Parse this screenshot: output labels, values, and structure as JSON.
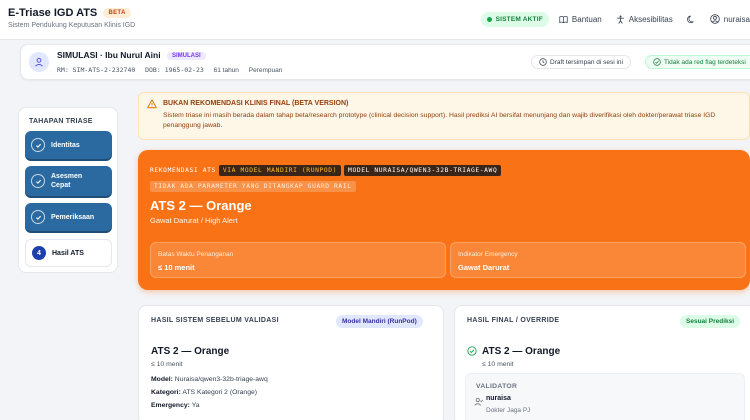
{
  "app": {
    "title": "E-Triase IGD ATS",
    "beta_label": "BETA",
    "subtitle": "Sistem Pendukung Keputusan Klinis IGD"
  },
  "topnav": {
    "status": "SISTEM AKTIF",
    "help": "Bantuan",
    "accessibility": "Aksesibilitas",
    "user": "nuraisa"
  },
  "patient": {
    "name": "SIMULASI · Ibu Nurul Aini",
    "sim_badge": "SIMULASI",
    "rm": "RM: SIM-ATS-2-232740",
    "dob": "DOB: 1965-02-23",
    "age": "61 tahun",
    "gender": "Perempuan",
    "draft_status": "Draft tersimpan di sesi ini",
    "redflag_status": "Tidak ada red flag terdeteksi"
  },
  "stepper": {
    "title": "TAHAPAN TRIASE",
    "steps": [
      {
        "label": "Identitas"
      },
      {
        "label": "Asesmen Cepat"
      },
      {
        "label": "Pemeriksaan"
      },
      {
        "label": "Hasil ATS",
        "number": "4"
      }
    ]
  },
  "warning": {
    "title": "BUKAN REKOMENDASI KLINIS FINAL (BETA VERSION)",
    "body": "Sistem triase ini masih berada dalam tahap beta/research prototype (clinical decision support). Hasil prediksi AI bersifat menunjang dan wajib diverifikasi oleh dokter/perawat triase IGD penanggung jawab."
  },
  "result": {
    "chip_prefix": "REKOMENDASI ATS",
    "chip_model_source": "VIA MODEL MANDIRI (RUNPOD)",
    "chip_model_name": "MODEL NURAISA/QWEN3-32B-TRIAGE-AWQ",
    "chip_guardrail": "TIDAK ADA PARAMETER YANG DITANGKAP GUARD RAIL",
    "level": "ATS 2 — Orange",
    "level_desc": "Gawat Darurat / High Alert",
    "time_label": "Batas Waktu Penanganan",
    "time_value": "≤ 10 menit",
    "emergency_label": "Indikator Emergency",
    "emergency_value": "Gawat Darurat"
  },
  "system_card": {
    "header": "HASIL SISTEM SEBELUM VALIDASI",
    "badge": "Model Mandiri (RunPod)",
    "title": "ATS 2 — Orange",
    "sub": "≤ 10 menit",
    "model_key": "Model:",
    "model_value": "Nuraisa/qwen3-32b-triage-awq",
    "category_key": "Kategori:",
    "category_value": "ATS Kategori 2 (Orange)",
    "emergency_key": "Emergency:",
    "emergency_value": "Ya"
  },
  "final_card": {
    "header": "HASIL FINAL / OVERRIDE",
    "badge": "Sesuai Prediksi",
    "title": "ATS 2 — Orange",
    "sub": "≤ 10 menit",
    "validator_header": "VALIDATOR",
    "validator_name": "nuraisa",
    "validator_role": "Dokter Jaga PJ"
  },
  "colors": {
    "accent_orange": "#f97316",
    "step_blue": "#2b6aa0",
    "status_green": "#15803d"
  }
}
